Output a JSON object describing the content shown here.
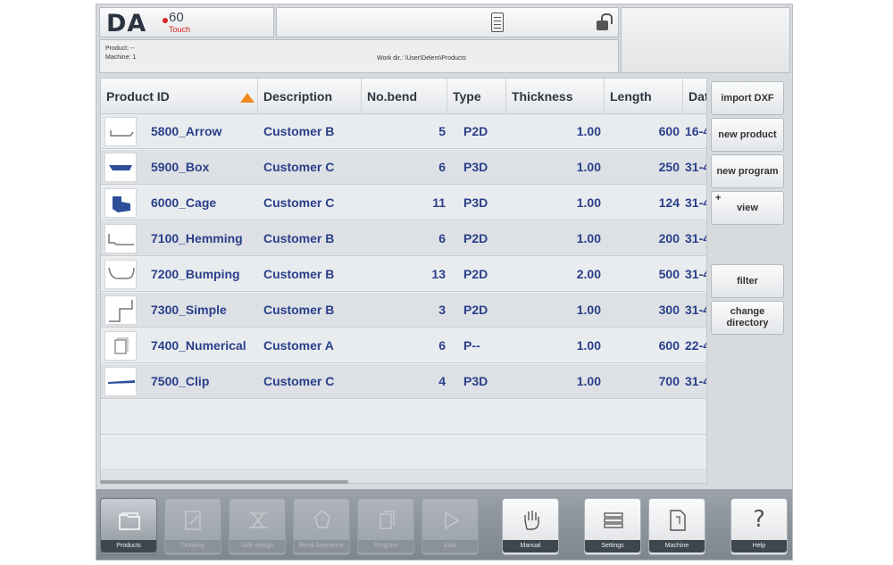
{
  "header": {
    "logo_da": "DA",
    "logo_num": "60",
    "logo_touch": "Touch",
    "product_line": "Product: --",
    "machine_line": "Machine: 1",
    "workdir_line": "Work dir.: \\User\\Delem\\Products"
  },
  "table": {
    "columns": [
      "Product ID",
      "Description",
      "No.bend",
      "Type",
      "Thickness",
      "Length",
      "Dat"
    ],
    "rows": [
      {
        "id": "5800_Arrow",
        "desc": "Customer B",
        "bends": "5",
        "type": "P2D",
        "thickness": "1.00",
        "length": "600",
        "date": "16-4"
      },
      {
        "id": "5900_Box",
        "desc": "Customer C",
        "bends": "6",
        "type": "P3D",
        "thickness": "1.00",
        "length": "250",
        "date": "31-4"
      },
      {
        "id": "6000_Cage",
        "desc": "Customer C",
        "bends": "11",
        "type": "P3D",
        "thickness": "1.00",
        "length": "124",
        "date": "31-4"
      },
      {
        "id": "7100_Hemming",
        "desc": "Customer B",
        "bends": "6",
        "type": "P2D",
        "thickness": "1.00",
        "length": "200",
        "date": "31-4"
      },
      {
        "id": "7200_Bumping",
        "desc": "Customer B",
        "bends": "13",
        "type": "P2D",
        "thickness": "2.00",
        "length": "500",
        "date": "31-4"
      },
      {
        "id": "7300_Simple",
        "desc": "Customer B",
        "bends": "3",
        "type": "P2D",
        "thickness": "1.00",
        "length": "300",
        "date": "31-4"
      },
      {
        "id": "7400_Numerical",
        "desc": "Customer A",
        "bends": "6",
        "type": "P--",
        "thickness": "1.00",
        "length": "600",
        "date": "22-4"
      },
      {
        "id": "7500_Clip",
        "desc": "Customer C",
        "bends": "4",
        "type": "P3D",
        "thickness": "1.00",
        "length": "700",
        "date": "31-4"
      }
    ]
  },
  "side_buttons": {
    "import_dxf": "import DXF",
    "new_product": "new product",
    "new_program": "new program",
    "view": "view",
    "view_marker": "+",
    "filter": "filter",
    "change_directory": "change directory"
  },
  "nav": {
    "products": "Products",
    "drawing": "Drawing",
    "side_design": "Side design",
    "bend_sequence": "Bend Sequence",
    "program": "Program",
    "auto": "Auto",
    "manual": "Manual",
    "settings": "Settings",
    "machine": "Machine",
    "help": "Help",
    "help_glyph": "?"
  },
  "colors": {
    "sort_arrow": "#f0891e",
    "row_text": "#2a3f8a",
    "logo_accent": "#d6261f"
  }
}
